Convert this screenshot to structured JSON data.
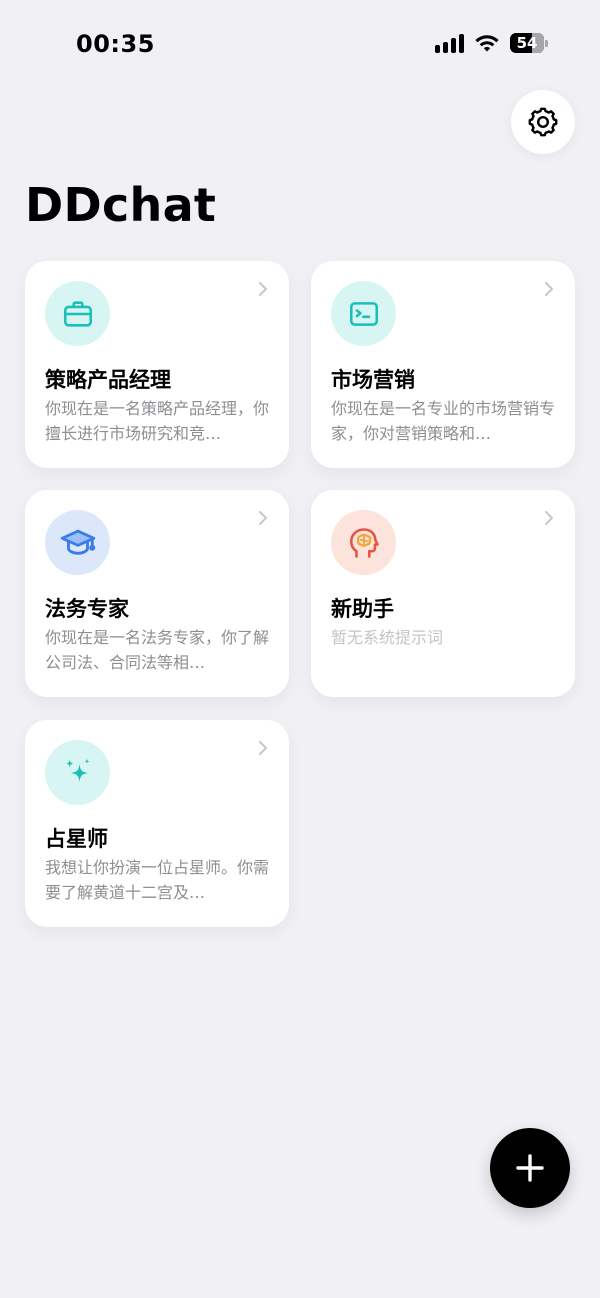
{
  "status_bar": {
    "time": "00:35",
    "battery": "54"
  },
  "app": {
    "title": "DDchat"
  },
  "cards": [
    {
      "title": "策略产品经理",
      "description": "你现在是一名策略产品经理，你擅长进行市场研究和竞…",
      "icon": "briefcase-icon",
      "icon_bg": "#D7F5F2",
      "icon_color": "#1CBFB8"
    },
    {
      "title": "市场营销",
      "description": "你现在是一名专业的市场营销专家，你对营销策略和…",
      "icon": "terminal-icon",
      "icon_bg": "#D7F5F2",
      "icon_color": "#1CBFB8"
    },
    {
      "title": "法务专家",
      "description": "你现在是一名法务专家，你了解公司法、合同法等相…",
      "icon": "graduation-cap-icon",
      "icon_bg": "#DCE7FA",
      "icon_color": "#3B7BEA"
    },
    {
      "title": "新助手",
      "description": "暂无系统提示词",
      "icon": "brain-head-icon",
      "icon_bg": "#FCE3DC",
      "icon_color": "#E8553F"
    },
    {
      "title": "占星师",
      "description": "我想让你扮演一位占星师。你需要了解黄道十二宫及…",
      "icon": "sparkles-icon",
      "icon_bg": "#D7F5F2",
      "icon_color": "#1CBFB8"
    }
  ],
  "colors": {
    "background": "#F0F0F5",
    "card": "#FFFFFF",
    "text_secondary": "#8E8E93",
    "fab": "#000000"
  }
}
